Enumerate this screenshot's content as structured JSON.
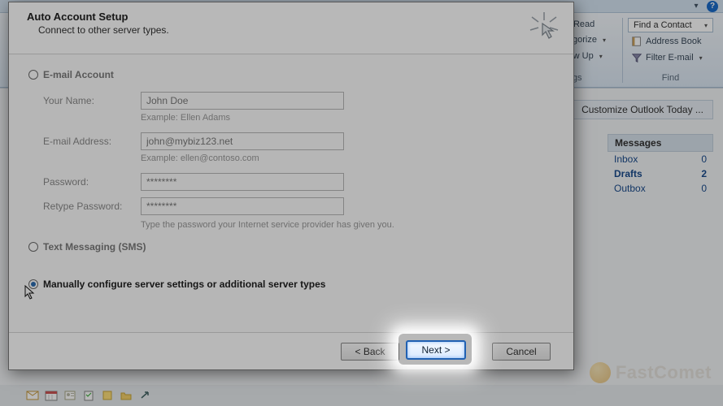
{
  "topbar": {
    "help": "?"
  },
  "ribbon": {
    "tags": {
      "unread_read": "Unread/ Read",
      "categorize": "Categorize",
      "follow_up": "Follow Up",
      "group_label": "Tags"
    },
    "find": {
      "find_contact": "Find a Contact",
      "address_book": "Address Book",
      "filter_email": "Filter E-mail",
      "group_label": "Find"
    }
  },
  "today": {
    "title": "Customize Outlook Today ..."
  },
  "messages": {
    "header": "Messages",
    "rows": [
      {
        "label": "Inbox",
        "count": "0",
        "bold": false
      },
      {
        "label": "Drafts",
        "count": "2",
        "bold": true
      },
      {
        "label": "Outbox",
        "count": "0",
        "bold": false
      }
    ]
  },
  "dialog": {
    "title": "Auto Account Setup",
    "subtitle": "Connect to other server types.",
    "options": {
      "email_account": "E-mail Account",
      "text_messaging": "Text Messaging (SMS)",
      "manual": "Manually configure server settings or additional server types"
    },
    "form": {
      "your_name_label": "Your Name:",
      "your_name_value": "John Doe",
      "your_name_hint": "Example: Ellen Adams",
      "email_label": "E-mail Address:",
      "email_value": "john@mybiz123.net",
      "email_hint": "Example: ellen@contoso.com",
      "password_label": "Password:",
      "password_value": "********",
      "retype_label": "Retype Password:",
      "retype_value": "********",
      "password_hint": "Type the password your Internet service provider has given you."
    },
    "buttons": {
      "back": "< Back",
      "next": "Next >",
      "cancel": "Cancel"
    }
  },
  "watermark": "FastComet"
}
